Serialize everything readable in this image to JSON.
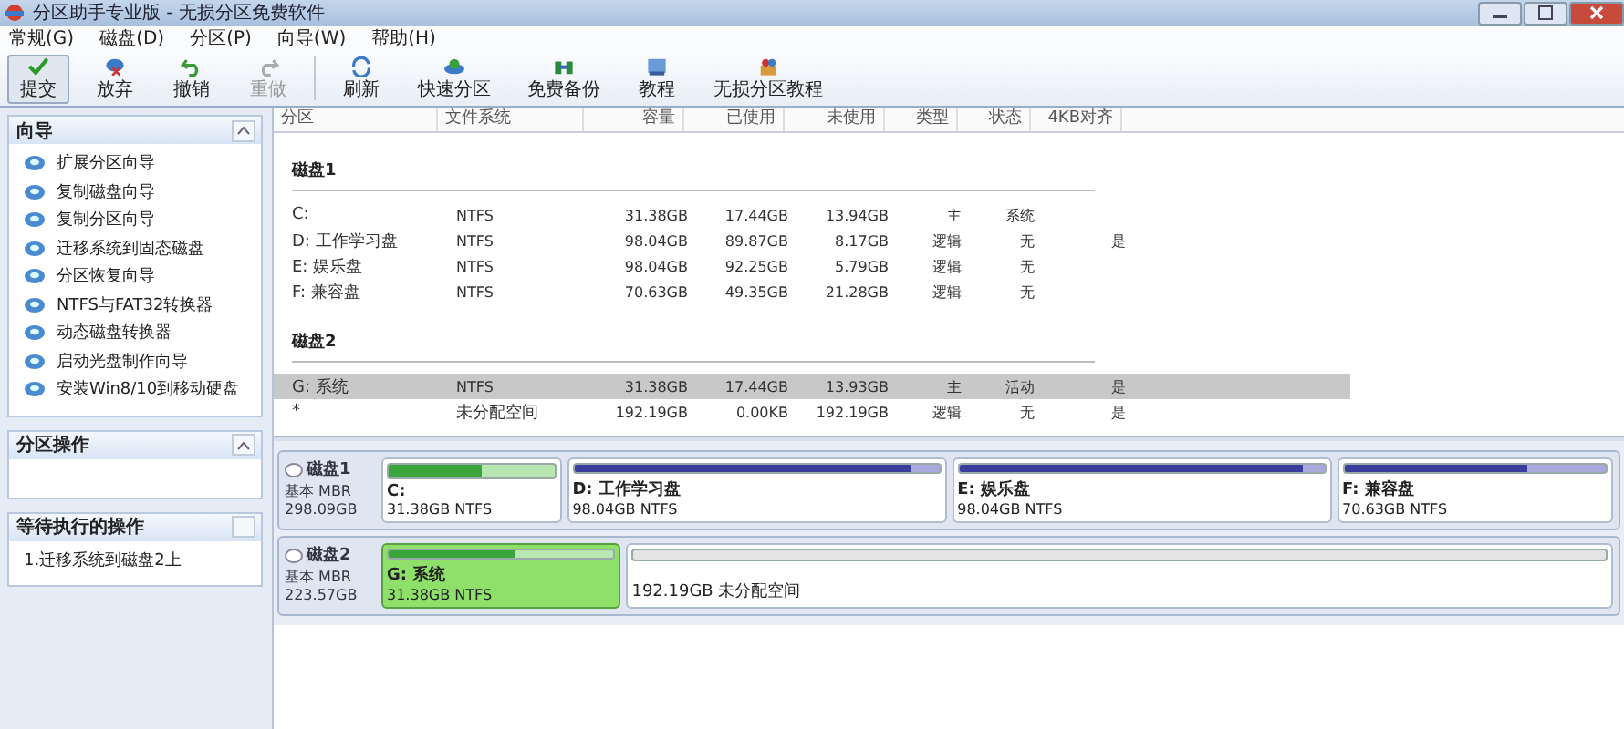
{
  "window": {
    "title": "分区助手专业版 - 无损分区免费软件"
  },
  "menu": [
    "常规(G)",
    "磁盘(D)",
    "分区(P)",
    "向导(W)",
    "帮助(H)"
  ],
  "toolbar": [
    {
      "label": "提交",
      "kind": "check",
      "selected": true,
      "disabled": false
    },
    {
      "label": "放弃",
      "kind": "discard",
      "selected": false,
      "disabled": false
    },
    {
      "label": "撤销",
      "kind": "undo",
      "selected": false,
      "disabled": false
    },
    {
      "label": "重做",
      "kind": "redo",
      "selected": false,
      "disabled": true
    },
    {
      "label": "刷新",
      "kind": "refresh",
      "selected": false,
      "disabled": false
    },
    {
      "label": "快速分区",
      "kind": "disk",
      "selected": false,
      "disabled": false
    },
    {
      "label": "免费备份",
      "kind": "backup",
      "selected": false,
      "disabled": false
    },
    {
      "label": "教程",
      "kind": "book",
      "selected": false,
      "disabled": false
    },
    {
      "label": "无损分区教程",
      "kind": "box",
      "selected": false,
      "disabled": false
    }
  ],
  "sidebar": {
    "panels": [
      {
        "title": "向导",
        "expanded": true,
        "items": [
          "扩展分区向导",
          "复制磁盘向导",
          "复制分区向导",
          "迁移系统到固态磁盘",
          "分区恢复向导",
          "NTFS与FAT32转换器",
          "动态磁盘转换器",
          "启动光盘制作向导",
          "安装Win8/10到移动硬盘"
        ]
      },
      {
        "title": "分区操作",
        "expanded": true
      },
      {
        "title": "等待执行的操作",
        "expanded": false,
        "items": [
          "1.迁移系统到磁盘2上"
        ]
      }
    ]
  },
  "table": {
    "columns": [
      "分区",
      "文件系统",
      "容量",
      "已使用",
      "未使用",
      "类型",
      "状态",
      "4KB对齐"
    ],
    "groups": [
      {
        "name": "磁盘1",
        "rows": [
          {
            "cells": [
              "C:",
              "NTFS",
              "31.38GB",
              "17.44GB",
              "13.94GB",
              "主",
              "系统",
              ""
            ],
            "selected": false
          },
          {
            "cells": [
              "D: 工作学习盘",
              "NTFS",
              "98.04GB",
              "89.87GB",
              "8.17GB",
              "逻辑",
              "无",
              "是"
            ],
            "selected": false
          },
          {
            "cells": [
              "E: 娱乐盘",
              "NTFS",
              "98.04GB",
              "92.25GB",
              "5.79GB",
              "逻辑",
              "无",
              ""
            ],
            "selected": false
          },
          {
            "cells": [
              "F: 兼容盘",
              "NTFS",
              "70.63GB",
              "49.35GB",
              "21.28GB",
              "逻辑",
              "无",
              ""
            ],
            "selected": false
          }
        ]
      },
      {
        "name": "磁盘2",
        "rows": [
          {
            "cells": [
              "G: 系统",
              "NTFS",
              "31.38GB",
              "17.44GB",
              "13.93GB",
              "主",
              "活动",
              "是"
            ],
            "selected": true
          },
          {
            "cells": [
              "*",
              "未分配空间",
              "192.19GB",
              "0.00KB",
              "192.19GB",
              "逻辑",
              "无",
              "是"
            ],
            "selected": false
          }
        ]
      }
    ]
  },
  "disk_map": [
    {
      "name": "磁盘1",
      "type": "基本 MBR",
      "size": "298.09GB",
      "partitions": [
        {
          "kind": "primary",
          "name": "C:",
          "size_label": "31.38GB NTFS",
          "level": 0.56,
          "selected": false
        },
        {
          "kind": "logical",
          "name": "D: 工作学习盘",
          "size_label": "98.04GB NTFS",
          "level": 0.92,
          "selected": false
        },
        {
          "kind": "logical",
          "name": "E: 娱乐盘",
          "size_label": "98.04GB NTFS",
          "level": 0.94,
          "selected": false
        },
        {
          "kind": "logical",
          "name": "F: 兼容盘",
          "size_label": "70.63GB NTFS",
          "level": 0.7,
          "selected": false
        }
      ]
    },
    {
      "name": "磁盘2",
      "type": "基本 MBR",
      "size": "223.57GB",
      "partitions": [
        {
          "kind": "primary",
          "name": "G: 系统",
          "size_label": "31.38GB NTFS",
          "level": 0.56,
          "selected": true
        },
        {
          "kind": "unallocated",
          "size_label": "192.19GB 未分配空间",
          "selected": false
        }
      ]
    }
  ]
}
